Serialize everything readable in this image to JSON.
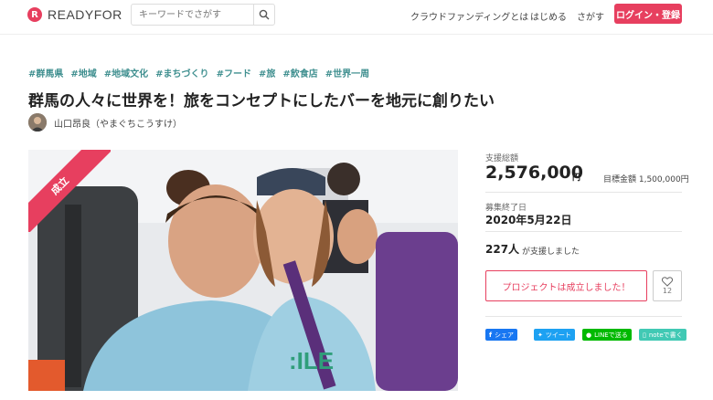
{
  "header": {
    "logo_text": "READYFOR",
    "search_placeholder": "キーワードでさがす",
    "nav": [
      "クラウドファンディングとは",
      "はじめる",
      "さがす"
    ],
    "login_label": "ログイン・登録"
  },
  "tags": [
    "#群馬県",
    "#地域",
    "#地域文化",
    "#まちづくり",
    "#フード",
    "#旅",
    "#飲食店",
    "#世界一周"
  ],
  "title": "群馬の人々に世界を！旅をコンセプトにしたバーを地元に創りたい",
  "author": "山口昂良（やまぐちこうすけ）",
  "ribbon": "成立",
  "stats": {
    "total_label": "支援総額",
    "total_amount": "2,576,000",
    "currency": "円",
    "goal_label": "目標金額 1,500,000円",
    "end_label": "募集終了日",
    "end_date": "2020年5月22日",
    "supporters": "227人",
    "supporters_suffix": "が支援しました"
  },
  "cta_label": "プロジェクトは成立しました！",
  "like_count": "12",
  "share": {
    "facebook": "シェア",
    "twitter": "ツイート",
    "line": "LINEで送る",
    "note": "noteで書く"
  },
  "colors": {
    "brand": "#e73f5f",
    "tag": "#3f8f8f",
    "facebook": "#1877f2",
    "twitter": "#1da1f2",
    "line": "#00b900",
    "note": "#41c9b4"
  }
}
